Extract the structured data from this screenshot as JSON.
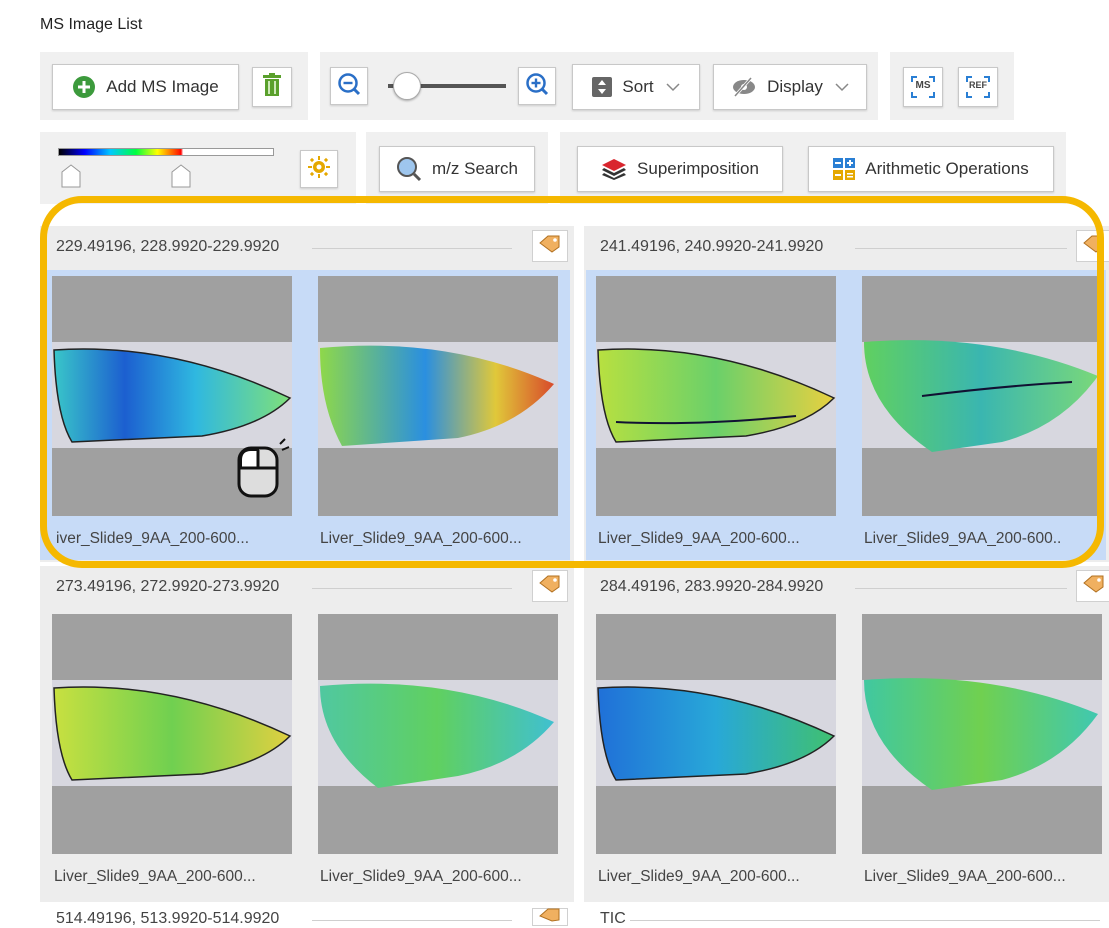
{
  "panel_title": "MS Image List",
  "toolbar": {
    "add_label": "Add MS Image",
    "sort_label": "Sort",
    "display_label": "Display",
    "ms_label": "MS",
    "ref_label": "REF",
    "zoom_level": 0.15,
    "mz_search_label": "m/z Search",
    "superimposition_label": "Superimposition",
    "arithmetic_label": "Arithmetic Operations",
    "colorbar": {
      "low": 0.06,
      "high": 0.57
    },
    "accent": "#f5b800"
  },
  "groups": [
    {
      "header": "229.49196, 228.9920-229.9920",
      "images": [
        {
          "caption": "iver_Slide9_9AA_200-600..."
        },
        {
          "caption": "Liver_Slide9_9AA_200-600..."
        }
      ]
    },
    {
      "header": "241.49196, 240.9920-241.9920",
      "images": [
        {
          "caption": "Liver_Slide9_9AA_200-600..."
        },
        {
          "caption": "Liver_Slide9_9AA_200-600.."
        }
      ]
    },
    {
      "header": "273.49196, 272.9920-273.9920",
      "images": [
        {
          "caption": "Liver_Slide9_9AA_200-600..."
        },
        {
          "caption": "Liver_Slide9_9AA_200-600..."
        }
      ]
    },
    {
      "header": "284.49196, 283.9920-284.9920",
      "images": [
        {
          "caption": "Liver_Slide9_9AA_200-600..."
        },
        {
          "caption": "Liver_Slide9_9AA_200-600..."
        }
      ]
    },
    {
      "header": "514.49196, 513.9920-514.9920",
      "images": []
    },
    {
      "header": "TIC",
      "images": []
    }
  ]
}
